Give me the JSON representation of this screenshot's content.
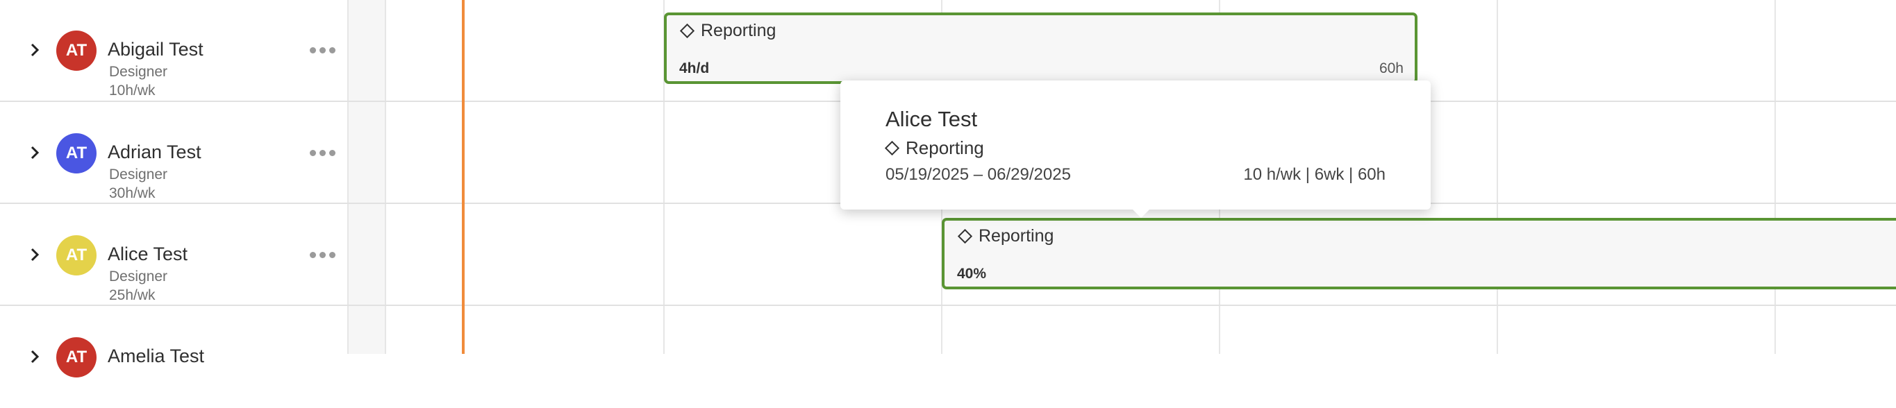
{
  "people": [
    {
      "initials": "AT",
      "name": "Abigail Test",
      "role": "Designer",
      "hours": "10h/wk",
      "avatar_color": "#c8342a"
    },
    {
      "initials": "AT",
      "name": "Adrian Test",
      "role": "Designer",
      "hours": "30h/wk",
      "avatar_color": "#4a56e2"
    },
    {
      "initials": "AT",
      "name": "Alice Test",
      "role": "Designer",
      "hours": "25h/wk",
      "avatar_color": "#e4d24a"
    },
    {
      "initials": "AT",
      "name": "Amelia Test",
      "role": "",
      "hours": "",
      "avatar_color": "#c8342a"
    }
  ],
  "bars": [
    {
      "project": "Reporting",
      "left_label": "4h/d",
      "right_label": "60h",
      "color": "#5a9534"
    },
    {
      "project": "Reporting",
      "left_label": "40%",
      "right_label": "",
      "color": "#5a9534"
    }
  ],
  "tooltip": {
    "name": "Alice Test",
    "project": "Reporting",
    "dates": "05/19/2025 – 06/29/2025",
    "stats": "10 h/wk | 6wk | 60h"
  },
  "colors": {
    "today_line": "#f08c3c",
    "grid": "#e1e1e1",
    "weekend": "#f6f6f6"
  }
}
